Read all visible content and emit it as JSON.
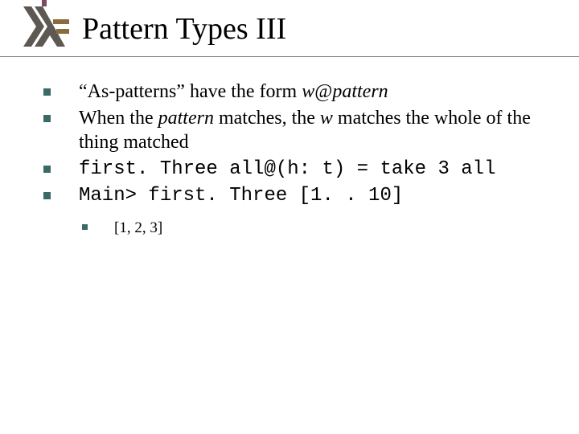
{
  "title": "Pattern Types III",
  "bullets": [
    {
      "pre": "“As-patterns” have the form ",
      "em1": "w",
      "mid": "@",
      "em2": "pattern"
    },
    {
      "pre": "When the ",
      "em1": "pattern",
      "mid": " matches, the ",
      "em2": "w",
      "post": " matches the whole of the thing matched"
    },
    {
      "code": "first. Three all@(h: t) = take 3 all"
    },
    {
      "code": "Main> first. Three [1. . 10]",
      "sub": [
        "[1, 2, 3]"
      ]
    }
  ],
  "colors": {
    "bullet": "#3a6a66",
    "rule": "#7a7a7a"
  }
}
